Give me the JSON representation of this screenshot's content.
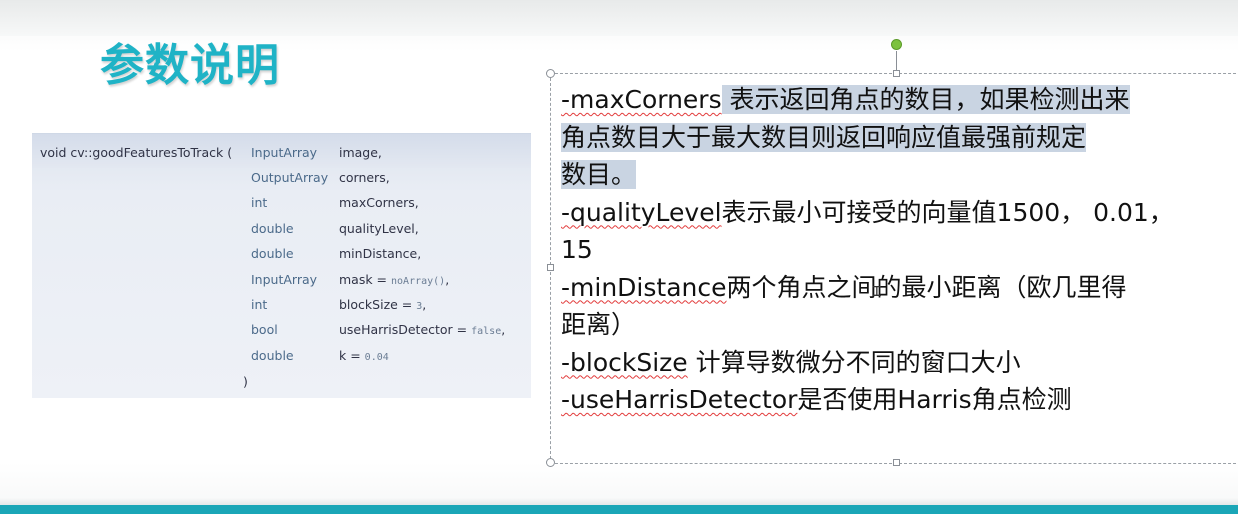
{
  "slide": {
    "title": "参数说明"
  },
  "code": {
    "signature": "void cv::goodFeaturesToTrack (",
    "params": [
      {
        "type": "InputArray",
        "name": "image,",
        "default": ""
      },
      {
        "type": "OutputArray",
        "name": "corners,",
        "default": ""
      },
      {
        "type": "int",
        "name": "maxCorners,",
        "default": ""
      },
      {
        "type": "double",
        "name": "qualityLevel,",
        "default": ""
      },
      {
        "type": "double",
        "name": "minDistance,",
        "default": ""
      },
      {
        "type": "InputArray",
        "name": "mask = ",
        "default": "noArray()",
        "suffix": ","
      },
      {
        "type": "int",
        "name": "blockSize = ",
        "default": "3",
        "suffix": ","
      },
      {
        "type": "bool",
        "name": "useHarrisDetector = ",
        "default": "false",
        "suffix": ","
      },
      {
        "type": "double",
        "name": "k = ",
        "default": "0.04",
        "suffix": ""
      }
    ],
    "closing": ")"
  },
  "description": {
    "line1_param": "-maxCorners",
    "line1_rest": " 表示返回角点的数目，如果检测出来",
    "line2": "角点数目大于最大数目则返回响应值最强前规定",
    "line3": "数目。",
    "line4_param": "-qualityLevel",
    "line4_rest": "表示最小可接受的向量值1500， 0.01，",
    "line5": "15",
    "line6_param": "-minDistance",
    "line6_rest": "两个角点之间的最小距离（欧几里得",
    "line7": "距离）",
    "line8_param": "-blockSize",
    "line8_rest": " 计算导数微分不同的窗口大小",
    "line9_param": "-useHarrisDetector",
    "line9_rest": "是否使用Harris角点检测"
  },
  "colors": {
    "accent": "#1fb3c6",
    "bottom_bar": "#1aa6b7",
    "selection": "#c9d4e2"
  }
}
